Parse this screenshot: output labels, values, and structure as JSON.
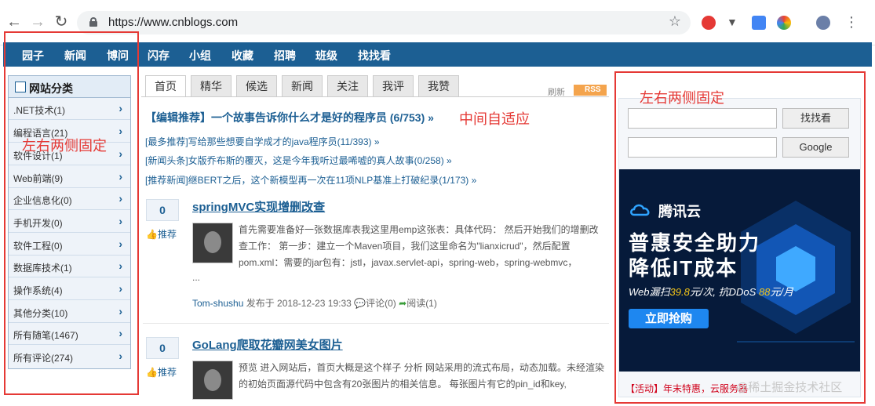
{
  "browser": {
    "url": "https://www.cnblogs.com"
  },
  "topnav": [
    "园子",
    "新闻",
    "博问",
    "闪存",
    "小组",
    "收藏",
    "招聘",
    "班级",
    "找找看"
  ],
  "sidebar": {
    "title": "网站分类",
    "items": [
      ".NET技术(1)",
      "编程语言(21)",
      "软件设计(1)",
      "Web前端(9)",
      "企业信息化(0)",
      "手机开发(0)",
      "软件工程(0)",
      "数据库技术(1)",
      "操作系统(4)",
      "其他分类(10)",
      "所有随笔(1467)",
      "所有评论(274)"
    ]
  },
  "tabs": [
    "首页",
    "精华",
    "候选",
    "新闻",
    "关注",
    "我评",
    "我赞"
  ],
  "toolbar": {
    "refresh": "刷新",
    "rss": "RSS"
  },
  "editor_pick": "【编辑推荐】一个故事告诉你什么才是好的程序员 (6/753) »",
  "news": [
    "[最多推荐]写给那些想要自学成才的java程序员(11/393) »",
    "[新闻头条]女版乔布斯的覆灭，这是今年我听过最唏嘘的真人故事(0/258) »",
    "[推荐新闻]继BERT之后，这个新模型再一次在11项NLP基准上打破纪录(1/173) »"
  ],
  "posts": [
    {
      "votes": "0",
      "digg": "推荐",
      "title": "springMVC实现增删改查",
      "summary": "首先需要准备好一张数据库表我这里用emp这张表：具体代码：  然后开始我们的增删改查工作：  第一步：建立一个Maven项目，我们这里命名为\"lianxicrud\"，然后配置pom.xml：需要的jar包有：jstl，javax.servlet-api，spring-web，spring-webmvc，",
      "ellipsis": "...",
      "author": "Tom-shushu",
      "posted": "发布于 2018-12-23 19:33",
      "comments": "评论(0)",
      "reads": "阅读(1)"
    },
    {
      "votes": "0",
      "digg": "推荐",
      "title": "GoLang爬取花瓣网美女图片",
      "summary": "预览 进入网站后，首页大概是这个样子 分析 网站采用的流式布局，动态加载。未经渲染的初始页面源代码中包含有20张图片的相关信息。 每张图片有它的pin_id和key,"
    }
  ],
  "search": {
    "btn1": "找找看",
    "btn2": "Google"
  },
  "ad": {
    "brand": "腾讯云",
    "line1": "普惠安全助力",
    "line2": "降低IT成本",
    "sub_a": "Web漏扫",
    "sub_b": "39.8",
    "sub_c": "元/次, 抗DDoS ",
    "sub_d": "88",
    "sub_e": "元/月",
    "button": "立即抢购"
  },
  "activity": "【活动】年末特惠，云服务器",
  "watermark": "@稀土掘金技术社区",
  "annotations": {
    "left": "左右两侧固定",
    "center": "中间自适应",
    "right": "左右两侧固定"
  },
  "colors": {
    "nav": "#1c5f93",
    "annotation": "#e53935",
    "ad_bg": "#061a3a"
  }
}
